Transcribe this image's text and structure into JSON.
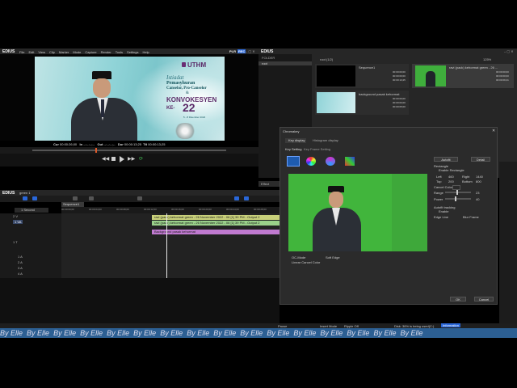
{
  "app": {
    "name": "EDIUS",
    "menu": [
      "File",
      "Edit",
      "View",
      "Clip",
      "Marker",
      "Mode",
      "Capture",
      "Render",
      "Tools",
      "Settings",
      "Help"
    ],
    "plr_label": "PLR",
    "rec_label": "REC",
    "bin_app_name": "EDIUS"
  },
  "player": {
    "cur_label": "Cur",
    "cur_tc": "00:00:26;00",
    "in_label": "In",
    "in_tc": "--:--:--;--",
    "out_label": "Out",
    "out_tc": "--:--:--;--",
    "dur_label": "Dur",
    "dur_tc": "00:00:13;25",
    "ttl_label": "Ttl",
    "ttl_tc": "00:00:13;25"
  },
  "preview": {
    "logo": "UTHM",
    "line1": "Istiadat",
    "line2": "Pemasyhuran",
    "line3": "Canselor, Pro-Canselor",
    "line4": "&",
    "line5": "KONVOKESYEN",
    "line6": "KE-",
    "num": "22",
    "dates": "5 - 8 Disember 2022"
  },
  "timeline": {
    "app_name": "EDIUS",
    "project": "green 1",
    "sequence_tab": "Sequence1",
    "scale": "1 Second",
    "ruler": [
      "00:00:00;00",
      "00:00:04;00",
      "00:00:08;00",
      "00:00:12;00",
      "00:00:16;00",
      "00:00:20;00",
      "00:00:24;00",
      "00:00:28;00",
      "00:00:32;00"
    ],
    "tracks": [
      "2 V",
      "1 VA",
      "1 T",
      "1 A",
      "2 A",
      "3 A",
      "4 A"
    ],
    "clips": {
      "clip1": "ravi (pack) kehormat green - 26 November 2022 - 06 [1] 39 PM - Output 2",
      "clip2": "ravi (pack) kehormat green - 26 November 2022 - 06 [1] 39 PM - Output 2",
      "clip3": "Background pasak kehormat"
    }
  },
  "bin": {
    "folder_label": "FOLDER",
    "root_label": "root",
    "breadcrumb": "root (1/2)",
    "zoom": "125%",
    "items": [
      {
        "name": "Sequence1",
        "tc": [
          "00:00:00;00",
          "00:00:00;00",
          "00:00:13;25"
        ]
      },
      {
        "name": "ravi (pack) kehormat green - 26 ...",
        "tc": [
          "00:00:00;00",
          "00:00:00;00",
          "00:00:09;41"
        ]
      },
      {
        "name": "background pasak kehormat",
        "tc": [
          "00:00:00;00",
          "00:00:00;00",
          "00:00:05;00"
        ]
      }
    ]
  },
  "effect_tab": "Effect",
  "chromakey": {
    "title": "Chromakey",
    "tab1": "Key display",
    "tab2": "Histogram display",
    "sub1": "Key Setting",
    "sub2": "Key Frame Setting",
    "autofit": "Autofit",
    "detail": "Detail",
    "rectangle_label": "Rectangle",
    "enable_rectangle": "Enable Rectangle",
    "left_label": "Left",
    "left": "460",
    "right_label": "Right",
    "right": "1440",
    "top_label": "Top",
    "top": "200",
    "bottom_label": "Bottom",
    "bottom": "800",
    "cancel_color": "Cancel Color",
    "range_label": "Range",
    "range": "23",
    "power_label": "Power",
    "power": "40",
    "autofit_tracking": "Autofit tracking",
    "enable": "Enable",
    "edge_line": "Edge Line",
    "blur_frame": "Blur Frame",
    "ocmode": "OC-Mode",
    "soft_edge": "Soft Edge",
    "linear_cancel": "Linear Cancel Color",
    "ok": "OK",
    "cancel": "Cancel",
    "key_color": "#41b53c"
  },
  "status": {
    "pause": "Pause",
    "insert_mode": "Insert Mode",
    "ripple": "Ripple Off",
    "disk": "Disk: 36% is being used(C:)",
    "information": "Information"
  },
  "watermark": "By Elle"
}
